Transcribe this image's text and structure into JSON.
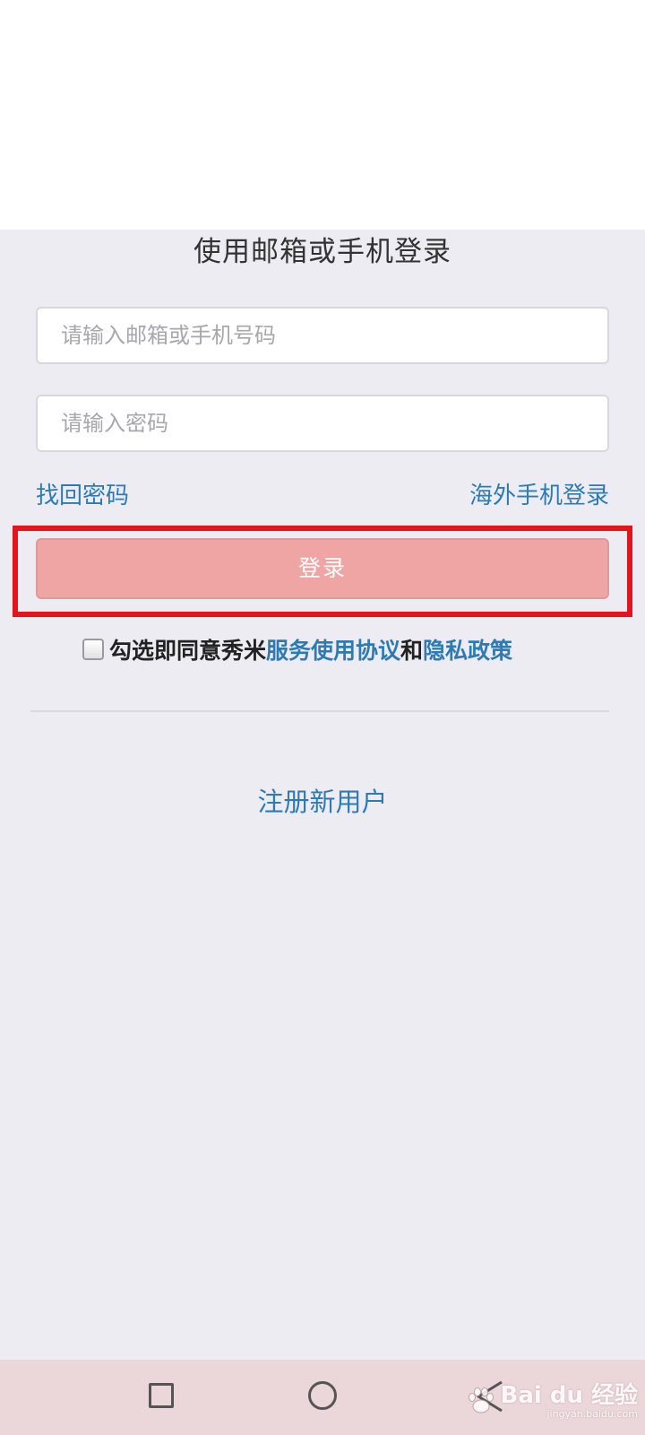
{
  "title": "使用邮箱或手机登录",
  "form": {
    "email_placeholder": "请输入邮箱或手机号码",
    "password_placeholder": "请输入密码"
  },
  "links": {
    "forgot_password": "找回密码",
    "overseas_login": "海外手机登录"
  },
  "login_button": "登录",
  "agreement": {
    "prefix": "勾选即同意秀米",
    "service_terms": "服务使用协议",
    "conjunction": "和",
    "privacy_policy": "隐私政策",
    "checked": false
  },
  "register_link": "注册新用户",
  "watermark": {
    "logo": "Bai du 经验",
    "url": "jingyan.baidu.com"
  },
  "colors": {
    "link": "#2e7bb4",
    "login_button_bg": "#f0a5a5",
    "highlight_frame": "#e4141e",
    "page_bg": "#ececf2",
    "nav_bar_bg": "#ebd6da"
  },
  "icons": {
    "nav_recent": "square-icon",
    "nav_home": "circle-icon",
    "nav_back": "back-triangle-icon"
  }
}
